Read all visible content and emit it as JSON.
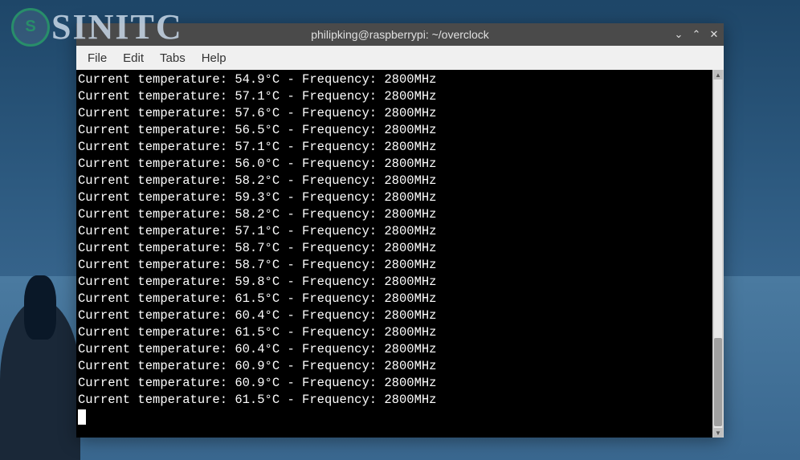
{
  "watermark": {
    "logo_text": "S",
    "brand_text": "SINITC"
  },
  "window": {
    "title": "philipking@raspberrypi: ~/overclock",
    "controls": {
      "minimize": "⌄",
      "maximize": "⌃",
      "close": "✕"
    }
  },
  "menu": {
    "items": [
      "File",
      "Edit",
      "Tabs",
      "Help"
    ]
  },
  "terminal": {
    "lines": [
      {
        "temp": "54.9",
        "freq": "2800"
      },
      {
        "temp": "57.1",
        "freq": "2800"
      },
      {
        "temp": "57.6",
        "freq": "2800"
      },
      {
        "temp": "56.5",
        "freq": "2800"
      },
      {
        "temp": "57.1",
        "freq": "2800"
      },
      {
        "temp": "56.0",
        "freq": "2800"
      },
      {
        "temp": "58.2",
        "freq": "2800"
      },
      {
        "temp": "59.3",
        "freq": "2800"
      },
      {
        "temp": "58.2",
        "freq": "2800"
      },
      {
        "temp": "57.1",
        "freq": "2800"
      },
      {
        "temp": "58.7",
        "freq": "2800"
      },
      {
        "temp": "58.7",
        "freq": "2800"
      },
      {
        "temp": "59.8",
        "freq": "2800"
      },
      {
        "temp": "61.5",
        "freq": "2800"
      },
      {
        "temp": "60.4",
        "freq": "2800"
      },
      {
        "temp": "61.5",
        "freq": "2800"
      },
      {
        "temp": "60.4",
        "freq": "2800"
      },
      {
        "temp": "60.9",
        "freq": "2800"
      },
      {
        "temp": "60.9",
        "freq": "2800"
      },
      {
        "temp": "61.5",
        "freq": "2800"
      }
    ],
    "line_prefix": "Current temperature: ",
    "line_mid": "°C - Frequency: ",
    "line_suffix": "MHz"
  }
}
